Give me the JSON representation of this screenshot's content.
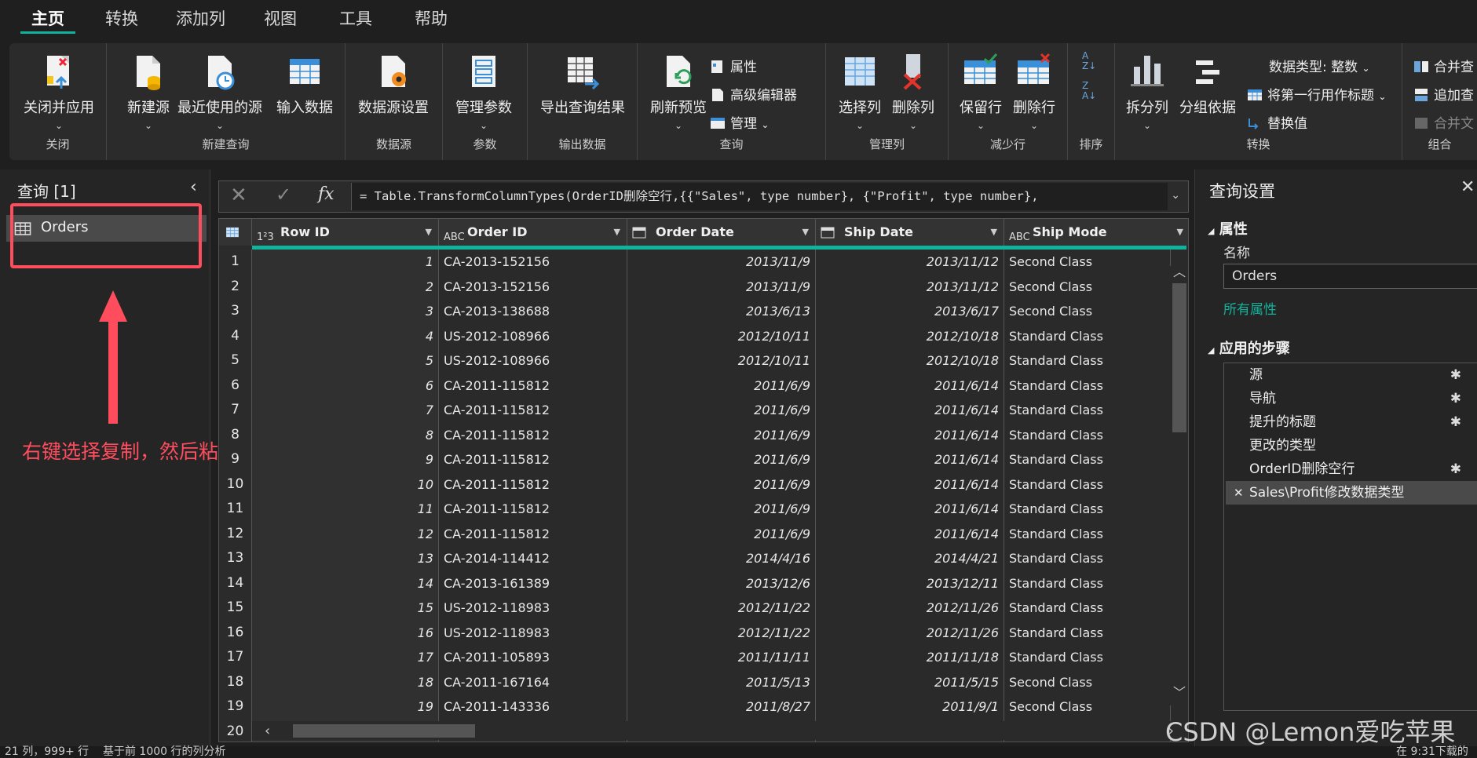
{
  "tabs": [
    "主页",
    "转换",
    "添加列",
    "视图",
    "工具",
    "帮助"
  ],
  "ribbon": {
    "close_apply": "关闭并应用",
    "group_close": "关闭",
    "new_source": "新建源",
    "recent_sources": "最近使用的源",
    "enter_data": "输入数据",
    "group_new_query": "新建查询",
    "data_source_settings": "数据源设置",
    "group_data_sources": "数据源",
    "manage_params": "管理参数",
    "group_params": "参数",
    "export_results": "导出查询结果",
    "group_export": "输出数据",
    "refresh_preview": "刷新预览",
    "properties": "属性",
    "advanced_editor": "高级编辑器",
    "manage": "管理",
    "group_query": "查询",
    "choose_columns": "选择列",
    "remove_columns": "删除列",
    "group_manage_columns": "管理列",
    "keep_rows": "保留行",
    "remove_rows": "删除行",
    "group_reduce_rows": "减少行",
    "group_sort": "排序",
    "split_column": "拆分列",
    "group_by": "分组依据",
    "data_type": "数据类型: 整数",
    "first_row_headers": "将第一行用作标题",
    "replace_values": "替换值",
    "group_transform": "转换",
    "merge_queries": "合并查",
    "append_queries": "追加查",
    "combine_files": "合并文",
    "group_combine": "组合"
  },
  "left_panel": {
    "title": "查询 [1]",
    "query_name": "Orders",
    "annotation": "右键选择复制，然后粘贴"
  },
  "formula": "= Table.TransformColumnTypes(OrderID删除空行,{{\"Sales\", type number}, {\"Profit\", type number},",
  "columns": [
    {
      "name": "Row ID",
      "type_icon": "1²3"
    },
    {
      "name": "Order ID",
      "type_icon": "ABC"
    },
    {
      "name": "Order Date",
      "type_icon": "date-icon"
    },
    {
      "name": "Ship Date",
      "type_icon": "date-icon"
    },
    {
      "name": "Ship Mode",
      "type_icon": "ABC"
    }
  ],
  "rows": [
    [
      "1",
      "1",
      "CA-2013-152156",
      "2013/11/9",
      "2013/11/12",
      "Second Class"
    ],
    [
      "2",
      "2",
      "CA-2013-152156",
      "2013/11/9",
      "2013/11/12",
      "Second Class"
    ],
    [
      "3",
      "3",
      "CA-2013-138688",
      "2013/6/13",
      "2013/6/17",
      "Second Class"
    ],
    [
      "4",
      "4",
      "US-2012-108966",
      "2012/10/11",
      "2012/10/18",
      "Standard Class"
    ],
    [
      "5",
      "5",
      "US-2012-108966",
      "2012/10/11",
      "2012/10/18",
      "Standard Class"
    ],
    [
      "6",
      "6",
      "CA-2011-115812",
      "2011/6/9",
      "2011/6/14",
      "Standard Class"
    ],
    [
      "7",
      "7",
      "CA-2011-115812",
      "2011/6/9",
      "2011/6/14",
      "Standard Class"
    ],
    [
      "8",
      "8",
      "CA-2011-115812",
      "2011/6/9",
      "2011/6/14",
      "Standard Class"
    ],
    [
      "9",
      "9",
      "CA-2011-115812",
      "2011/6/9",
      "2011/6/14",
      "Standard Class"
    ],
    [
      "10",
      "10",
      "CA-2011-115812",
      "2011/6/9",
      "2011/6/14",
      "Standard Class"
    ],
    [
      "11",
      "11",
      "CA-2011-115812",
      "2011/6/9",
      "2011/6/14",
      "Standard Class"
    ],
    [
      "12",
      "12",
      "CA-2011-115812",
      "2011/6/9",
      "2011/6/14",
      "Standard Class"
    ],
    [
      "13",
      "13",
      "CA-2014-114412",
      "2014/4/16",
      "2014/4/21",
      "Standard Class"
    ],
    [
      "14",
      "14",
      "CA-2013-161389",
      "2013/12/6",
      "2013/12/11",
      "Standard Class"
    ],
    [
      "15",
      "15",
      "US-2012-118983",
      "2012/11/22",
      "2012/11/26",
      "Standard Class"
    ],
    [
      "16",
      "16",
      "US-2012-118983",
      "2012/11/22",
      "2012/11/26",
      "Standard Class"
    ],
    [
      "17",
      "17",
      "CA-2011-105893",
      "2011/11/11",
      "2011/11/18",
      "Standard Class"
    ],
    [
      "18",
      "18",
      "CA-2011-167164",
      "2011/5/13",
      "2011/5/15",
      "Second Class"
    ],
    [
      "19",
      "19",
      "CA-2011-143336",
      "2011/8/27",
      "2011/9/1",
      "Second Class"
    ],
    [
      "20",
      "",
      "",
      "",
      "",
      ""
    ]
  ],
  "right_panel": {
    "title": "查询设置",
    "properties_header": "属性",
    "name_label": "名称",
    "name_value": "Orders",
    "all_properties": "所有属性",
    "steps_header": "应用的步骤",
    "steps": [
      "源",
      "导航",
      "提升的标题",
      "更改的类型",
      "OrderID删除空行",
      "Sales\\Profit修改数据类型"
    ]
  },
  "status": {
    "left": "21 列，999+ 行    基于前 1000 行的列分析",
    "right": "在 9:31下载的"
  },
  "watermark": "CSDN @Lemon爱吃苹果",
  "colors": {
    "accent": "#10b39c",
    "annotation": "#ff4d5e"
  }
}
